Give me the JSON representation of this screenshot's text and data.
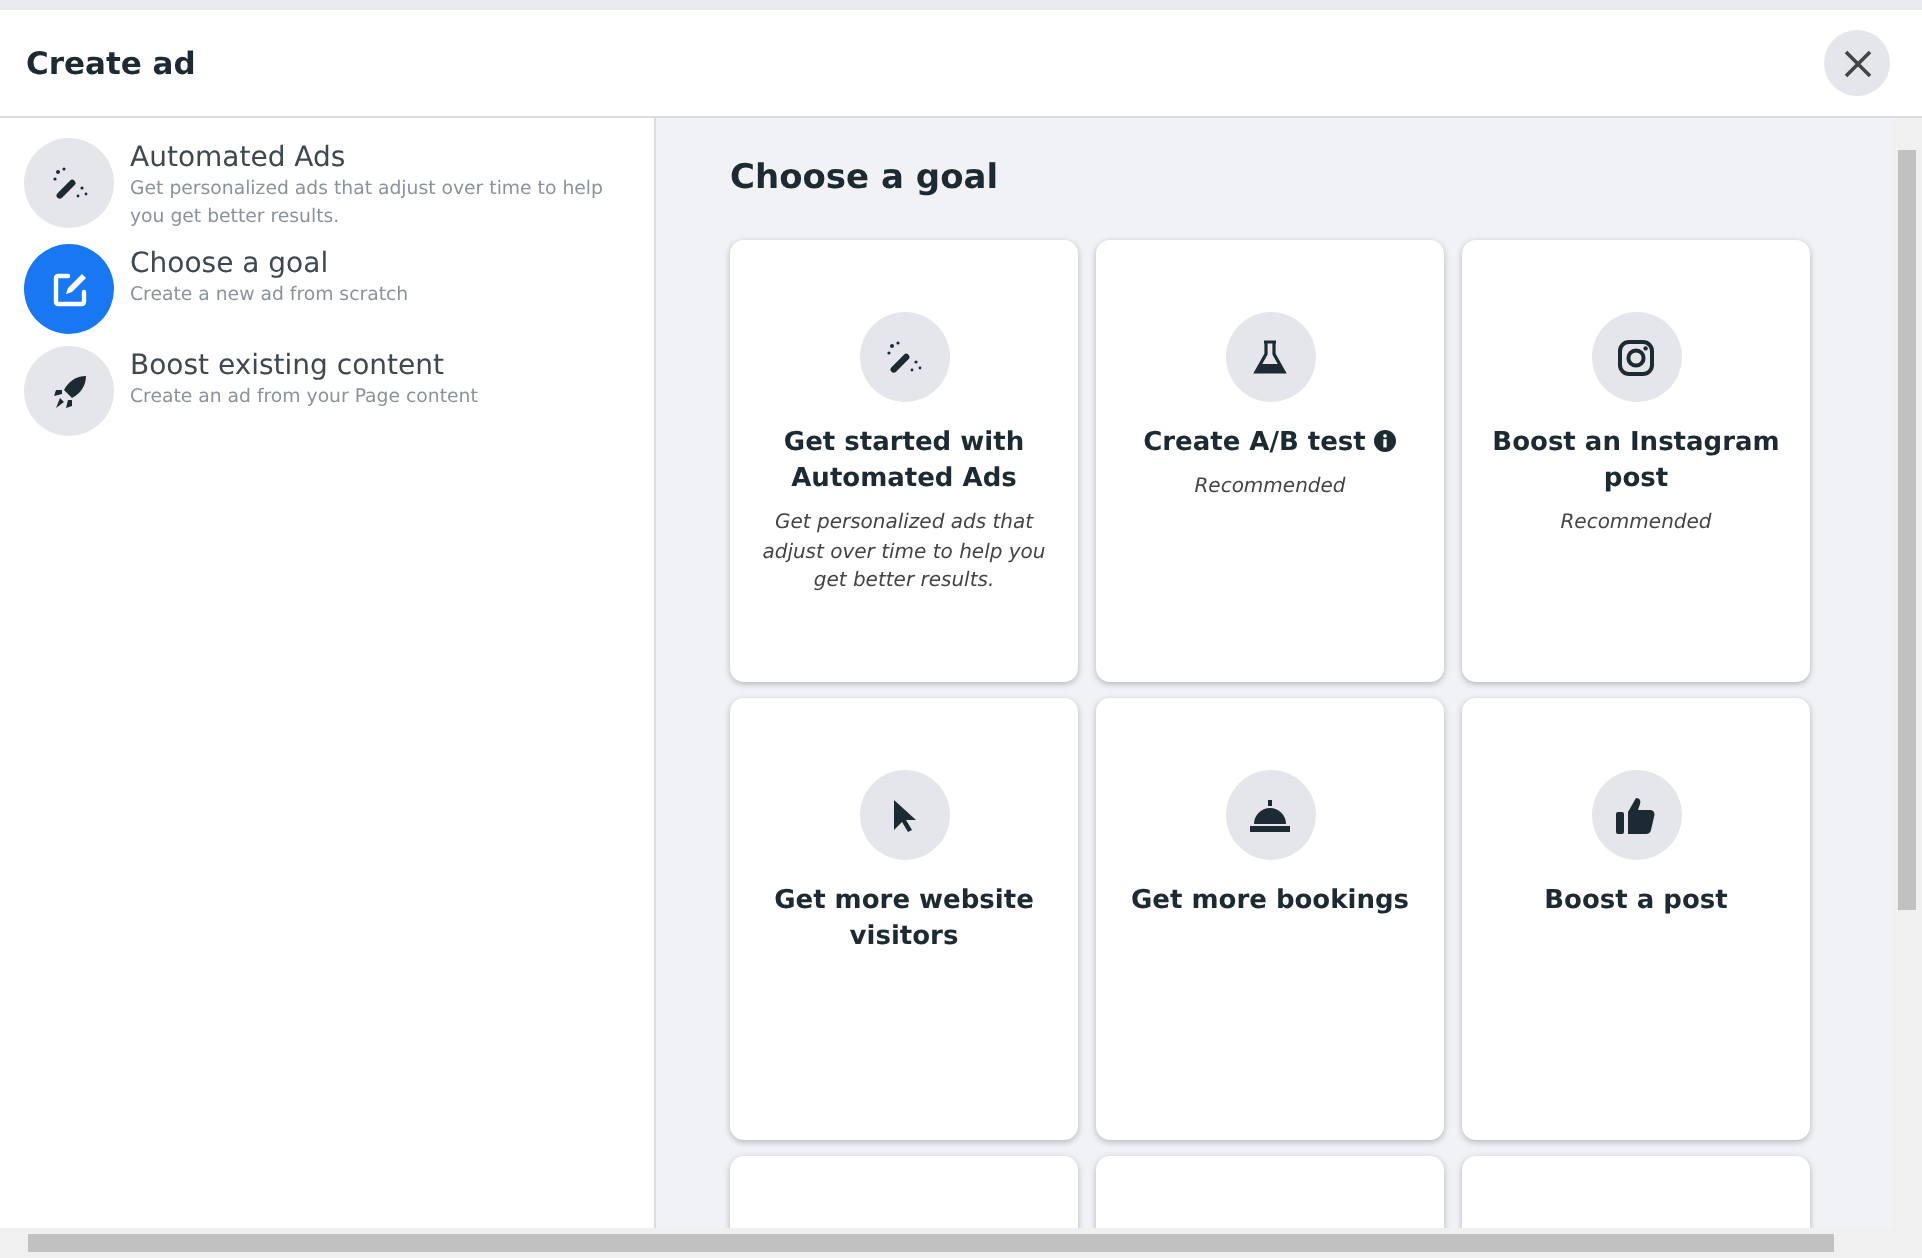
{
  "dialog": {
    "title": "Create ad"
  },
  "sidebar": {
    "items": [
      {
        "kind": "wand",
        "title": "Automated Ads",
        "description": "Get personalized ads that adjust over time to help you get better results.",
        "selected": false
      },
      {
        "kind": "edit",
        "title": "Choose a goal",
        "description": "Create a new ad from scratch",
        "selected": true
      },
      {
        "kind": "rocket",
        "title": "Boost existing content",
        "description": "Create an ad from your Page content",
        "selected": false
      }
    ]
  },
  "main": {
    "heading": "Choose a goal",
    "goals": [
      {
        "kind": "wand",
        "title": "Get started with Automated Ads",
        "description": "Get personalized ads that adjust over time to help you get better results.",
        "info": false
      },
      {
        "kind": "flask",
        "title": "Create A/B test",
        "description": "Recommended",
        "info": true
      },
      {
        "kind": "camera",
        "title": "Boost an Instagram post",
        "description": "Recommended",
        "info": false
      },
      {
        "kind": "cursor",
        "title": "Get more website visitors",
        "info": false
      },
      {
        "kind": "bell",
        "title": "Get more bookings",
        "info": false
      },
      {
        "kind": "thumb",
        "title": "Boost a post",
        "info": false
      }
    ]
  }
}
